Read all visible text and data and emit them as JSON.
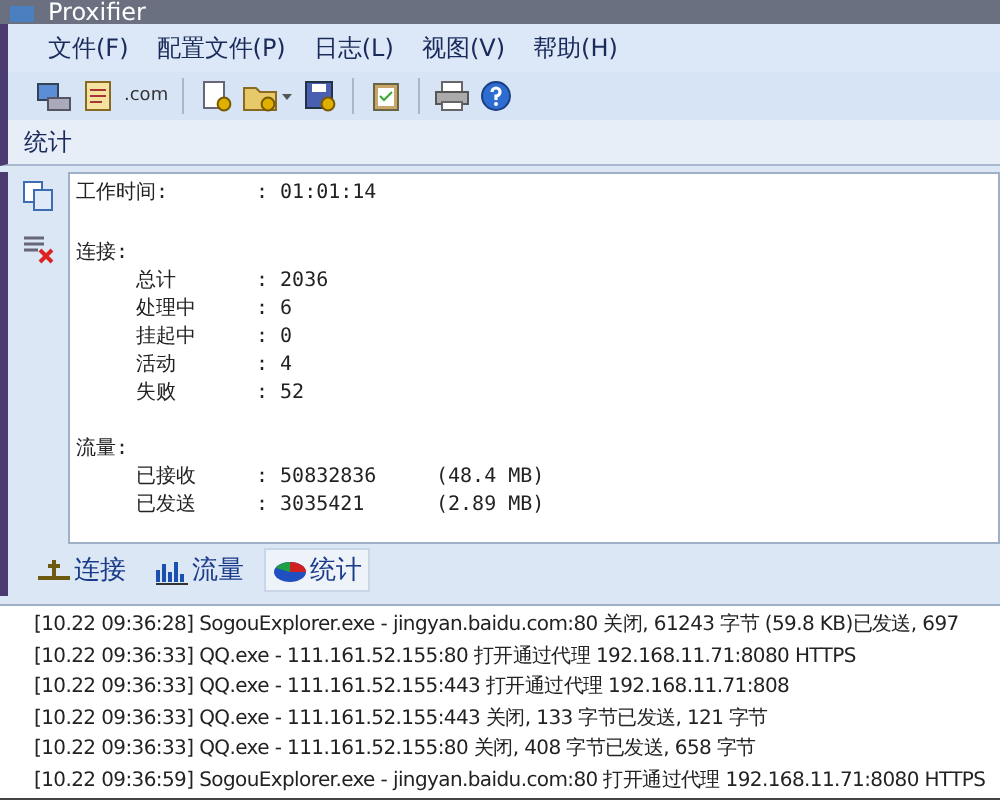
{
  "window": {
    "title": "Proxifier"
  },
  "menu": [
    "文件(F)",
    "配置文件(P)",
    "日志(L)",
    "视图(V)",
    "帮助(H)"
  ],
  "toolbar": {
    "domain_button": ".com"
  },
  "panel_title": "统计",
  "stats": {
    "uptime": {
      "label": "工作时间:",
      "value": ": 01:01:14"
    },
    "sections": [
      {
        "title": "连接:",
        "rows": [
          {
            "label": "总计",
            "value": ": 2036"
          },
          {
            "label": "处理中",
            "value": ": 6"
          },
          {
            "label": "挂起中",
            "value": ": 0"
          },
          {
            "label": "活动",
            "value": ": 4"
          },
          {
            "label": "失败",
            "value": ": 52"
          }
        ]
      },
      {
        "title": "流量:",
        "rows": [
          {
            "label": "已接收",
            "value": ": 50832836",
            "extra": "(48.4 MB)"
          },
          {
            "label": "已发送",
            "value": ": 3035421",
            "extra": "(2.89 MB)"
          }
        ]
      }
    ]
  },
  "tabs": [
    {
      "label": "连接",
      "selected": false
    },
    {
      "label": "流量",
      "selected": false
    },
    {
      "label": "统计",
      "selected": true
    }
  ],
  "log": [
    "[10.22 09:36:28] SogouExplorer.exe - jingyan.baidu.com:80 关闭, 61243 字节 (59.8 KB)已发送, 697",
    "[10.22 09:36:33] QQ.exe - 111.161.52.155:80 打开通过代理 192.168.11.71:8080 HTTPS",
    "[10.22 09:36:33] QQ.exe - 111.161.52.155:443 打开通过代理 192.168.11.71:808",
    "[10.22 09:36:33] QQ.exe - 111.161.52.155:443 关闭, 133 字节已发送, 121 字节",
    "[10.22 09:36:33] QQ.exe - 111.161.52.155:80 关闭, 408 字节已发送, 658 字节",
    "[10.22 09:36:59] SogouExplorer.exe - jingyan.baidu.com:80 打开通过代理 192.168.11.71:8080 HTTPS"
  ]
}
